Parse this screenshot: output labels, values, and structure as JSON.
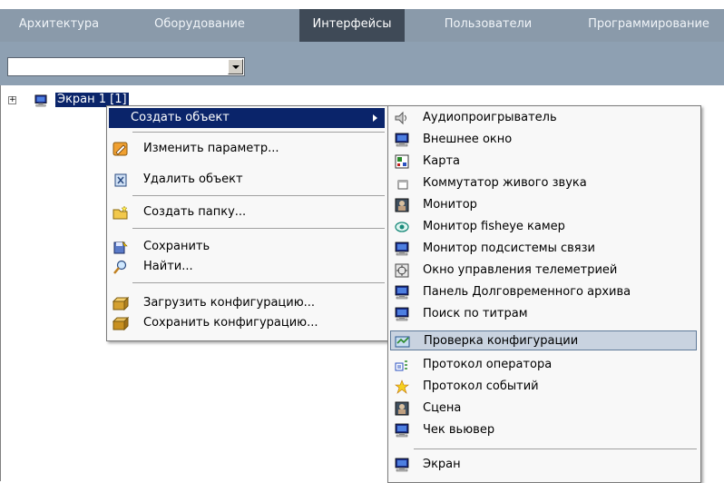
{
  "tabs": [
    {
      "label": "Архитектура",
      "active": false
    },
    {
      "label": "Оборудование",
      "active": false
    },
    {
      "label": "Интерфейсы",
      "active": true
    },
    {
      "label": "Пользователи",
      "active": false
    },
    {
      "label": "Программирование",
      "active": false
    }
  ],
  "toolbar": {
    "combo_value": ""
  },
  "tree": {
    "node_label": "Экран 1 [1]",
    "expander": "+"
  },
  "context_menu": {
    "items": [
      {
        "label": "Создать объект",
        "icon": "none",
        "highlighted": true,
        "has_submenu": true
      },
      {
        "label": "Изменить параметр...",
        "icon": "edit-icon"
      },
      {
        "label": "Удалить объект",
        "icon": "delete-icon"
      },
      {
        "label": "Создать папку...",
        "icon": "folder-new-icon"
      },
      {
        "label": "Сохранить",
        "icon": "save-icon"
      },
      {
        "label": "Найти...",
        "icon": "search-icon"
      },
      {
        "label": "Загрузить конфигурацию...",
        "icon": "load-config-icon"
      },
      {
        "label": "Сохранить конфигурацию...",
        "icon": "save-config-icon"
      }
    ]
  },
  "submenu": {
    "items": [
      {
        "label": "Аудиопроигрыватель",
        "icon": "speaker-icon"
      },
      {
        "label": "Внешнее окно",
        "icon": "monitor-icon"
      },
      {
        "label": "Карта",
        "icon": "map-icon"
      },
      {
        "label": "Коммутатор живого звука",
        "icon": "window-icon"
      },
      {
        "label": "Монитор",
        "icon": "camera-monitor-icon"
      },
      {
        "label": "Монитор fisheye камер",
        "icon": "fisheye-icon"
      },
      {
        "label": "Монитор подсистемы связи",
        "icon": "monitor-icon"
      },
      {
        "label": "Окно управления телеметрией",
        "icon": "telemetry-icon"
      },
      {
        "label": "Панель Долговременного архива",
        "icon": "monitor-icon"
      },
      {
        "label": "Поиск по титрам",
        "icon": "monitor-icon"
      },
      {
        "label": "Проверка конфигурации",
        "icon": "check-config-icon",
        "highlighted": true
      },
      {
        "label": "Протокол оператора",
        "icon": "operator-log-icon"
      },
      {
        "label": "Протокол событий",
        "icon": "event-log-icon"
      },
      {
        "label": "Сцена",
        "icon": "camera-monitor-icon"
      },
      {
        "label": "Чек вьювер",
        "icon": "monitor-icon"
      },
      {
        "label": "Экран",
        "icon": "monitor-icon"
      }
    ]
  },
  "colors": {
    "tabbar": "#8a9aaa",
    "tab_active": "#3f4a57",
    "toolbar": "#8ea0b2",
    "selection": "#0a246a",
    "submenu_hover": "#c9d3e0"
  }
}
